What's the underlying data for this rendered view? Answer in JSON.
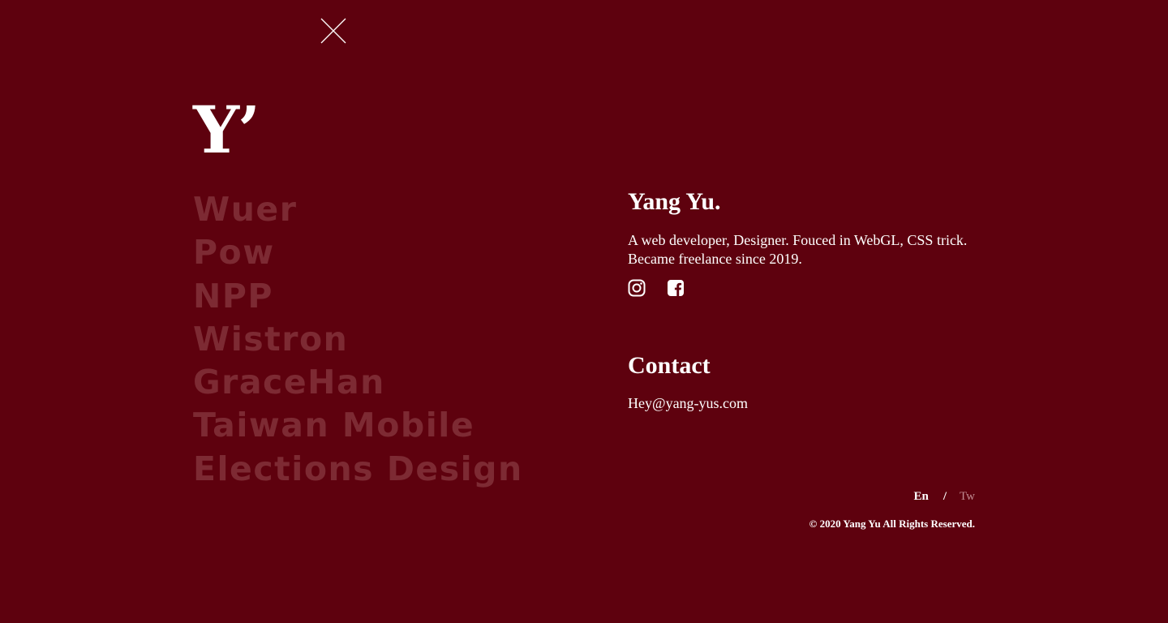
{
  "header": {
    "close_icon": "close-icon",
    "logo_text": "Y’"
  },
  "projects": [
    {
      "label": "Wuer"
    },
    {
      "label": "Pow"
    },
    {
      "label": "NPP"
    },
    {
      "label": "Wistron"
    },
    {
      "label": "GraceHan"
    },
    {
      "label": "Taiwan Mobile"
    },
    {
      "label": "Elections Design"
    }
  ],
  "profile": {
    "name": "Yang Yu.",
    "description_line1": "A web developer, Designer. Fouced in WebGL, CSS trick.",
    "description_line2": "Became freelance since 2019.",
    "socials": [
      {
        "icon": "instagram-icon"
      },
      {
        "icon": "facebook-icon"
      }
    ]
  },
  "contact": {
    "title": "Contact",
    "email": "Hey@yang-yus.com"
  },
  "language": {
    "en": "En",
    "separator": "/",
    "tw": "Tw"
  },
  "footer": {
    "copyright": "© 2020 Yang Yu All Rights Reserved."
  },
  "colors": {
    "background": "#5e010e",
    "project_text": "#7d2a33",
    "text": "#ffffff",
    "inactive_lang": "#c08a90"
  }
}
